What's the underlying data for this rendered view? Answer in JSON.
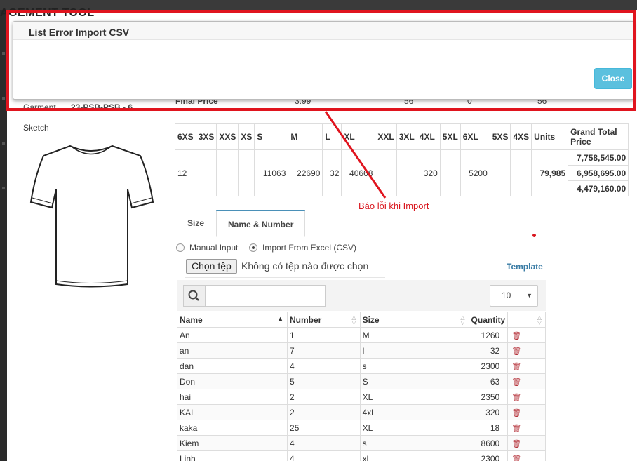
{
  "app": {
    "title": "AGEMENT TOOL"
  },
  "modal": {
    "title": "List Error Import CSV",
    "close_label": "Close"
  },
  "annotation": {
    "text": "Báo lỗi khi Import"
  },
  "product": {
    "garment_label": "Garment",
    "garment_value": "23-PSB-PSB - 6",
    "final_price_label": "Final Price",
    "final_price_values": [
      "3.99",
      "56",
      "0",
      "56"
    ]
  },
  "sketch": {
    "label": "Sketch",
    "icon": "tshirt-icon"
  },
  "size_table": {
    "headers": [
      "6XS",
      "3XS",
      "XXS",
      "XS",
      "S",
      "M",
      "L",
      "XL",
      "XXL",
      "3XL",
      "4XL",
      "5XL",
      "6XL",
      "5XS",
      "4XS",
      "Units",
      "Grand Total Price"
    ],
    "values": [
      "12",
      "",
      "",
      "",
      "11063",
      "22690",
      "32",
      "40668",
      "",
      "",
      "320",
      "",
      "5200",
      "",
      "",
      "79,985"
    ],
    "grand_totals": [
      "7,758,545.00",
      "6,958,695.00",
      "4,479,160.00"
    ]
  },
  "tabs": [
    {
      "label": "Size",
      "active": false
    },
    {
      "label": "Name & Number",
      "active": true
    }
  ],
  "input_mode": {
    "manual_label": "Manual Input",
    "import_label": "Import From Excel (CSV)",
    "selected": "import"
  },
  "file_input": {
    "button_label": "Chọn tệp",
    "status": "Không có tệp nào được chọn"
  },
  "template_link": "Template",
  "search": {
    "placeholder": "",
    "value": ""
  },
  "page_size": "10",
  "names_table": {
    "columns": [
      "Name",
      "Number",
      "Size",
      "Quantity"
    ],
    "rows": [
      {
        "name": "An",
        "number": "1",
        "size": "M",
        "quantity": "1260"
      },
      {
        "name": "an",
        "number": "7",
        "size": "l",
        "quantity": "32"
      },
      {
        "name": "dan",
        "number": "4",
        "size": "s",
        "quantity": "2300"
      },
      {
        "name": "Don",
        "number": "5",
        "size": "S",
        "quantity": "63"
      },
      {
        "name": "hai",
        "number": "2",
        "size": "XL",
        "quantity": "2350"
      },
      {
        "name": "KAI",
        "number": "2",
        "size": "4xl",
        "quantity": "320"
      },
      {
        "name": "kaka",
        "number": "25",
        "size": "XL",
        "quantity": "18"
      },
      {
        "name": "Kiem",
        "number": "4",
        "size": "s",
        "quantity": "8600"
      },
      {
        "name": "Linh",
        "number": "4",
        "size": "xl",
        "quantity": "2300"
      }
    ]
  },
  "colors": {
    "accent": "#5bc0de",
    "annotation": "#e0141e",
    "delete": "#b5323a",
    "link": "#3a7ca5"
  }
}
